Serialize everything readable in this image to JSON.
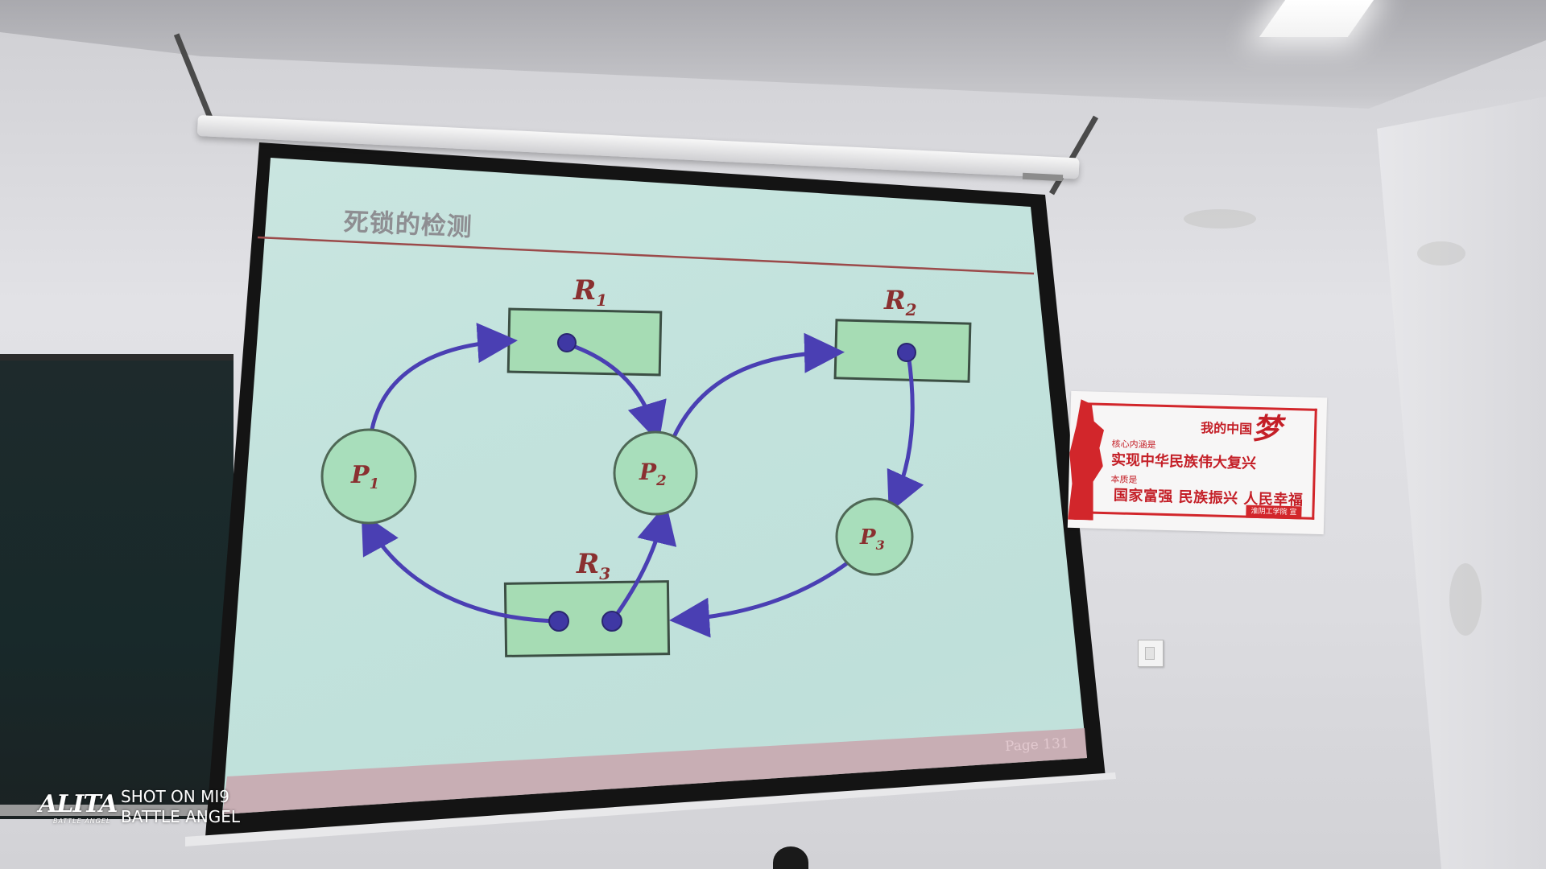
{
  "slide": {
    "title": "死锁的检测",
    "page": "Page 131",
    "colors": {
      "background": "#c3e3dd",
      "title_rule": "#9b4a4a",
      "resource_fill": "#a6dcb4",
      "process_fill": "#a8debb",
      "arrow": "#4a3fb3",
      "node_label": "#8a3030"
    },
    "resources": [
      {
        "label": "R",
        "sub": "1"
      },
      {
        "label": "R",
        "sub": "2"
      },
      {
        "label": "R",
        "sub": "3"
      }
    ],
    "processes": [
      {
        "label": "P",
        "sub": "1"
      },
      {
        "label": "P",
        "sub": "2"
      },
      {
        "label": "P",
        "sub": "3"
      }
    ]
  },
  "poster": {
    "heading": "我的中国",
    "dream_glyph": "梦",
    "subheading_1": "核心内涵是",
    "line_1": "实现中华民族伟大复兴",
    "subheading_2": "本质是",
    "line_2": "国家富强  民族振兴  人民幸福",
    "footer": "淮阴工学院 宣",
    "color": "#d2262b"
  },
  "watermark": {
    "logo": "ALITA",
    "logo_sub": "BATTLE ANGEL",
    "line_1": "SHOT ON MI9",
    "line_2": "BATTLE ANGEL"
  }
}
